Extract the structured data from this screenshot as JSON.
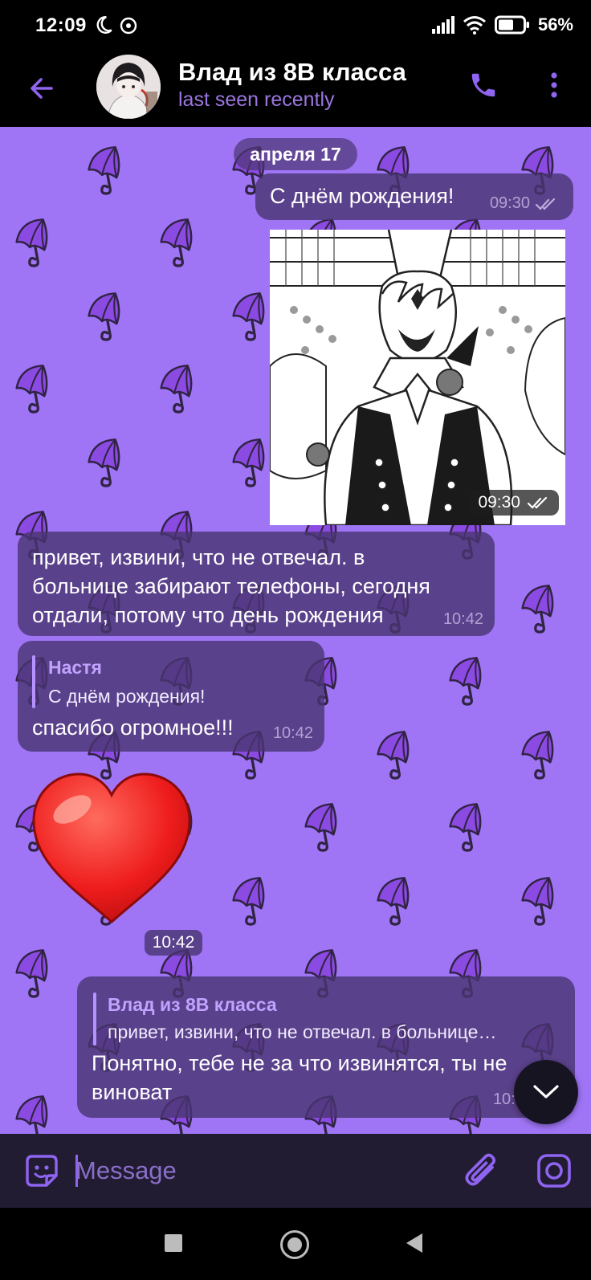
{
  "status_bar": {
    "time": "12:09",
    "battery": "56%"
  },
  "header": {
    "title": "Влад из 8В класса",
    "status": "last seen recently"
  },
  "chat": {
    "date_separator": "апреля 17",
    "messages": [
      {
        "id": "m1",
        "direction": "out",
        "text": "С днём рождения!",
        "time": "09:30",
        "status": "read"
      },
      {
        "id": "m2",
        "direction": "out",
        "type": "photo",
        "time": "09:30",
        "status": "read"
      },
      {
        "id": "m3",
        "direction": "in",
        "lines": [
          "привет, извини, что не отвечал. в",
          "больнице забирают телефоны, сегодня",
          "отдали, потому что день рождения"
        ],
        "time": "10:42"
      },
      {
        "id": "m4",
        "direction": "in",
        "reply_to": {
          "name": "Настя",
          "text": "С днём рождения!"
        },
        "text": "спасибо огромное!!!",
        "time": "10:42"
      },
      {
        "id": "m5",
        "direction": "in",
        "type": "sticker",
        "sticker": "red-heart",
        "time": "10:42"
      },
      {
        "id": "m6",
        "direction": "out",
        "reply_to": {
          "name": "Влад из 8В класса",
          "text": "привет, извини, что не отвечал. в больнице…"
        },
        "lines": [
          "Понятно, тебе не за что извинятся, ты не",
          "виноват"
        ],
        "time": "10:57",
        "status": "read"
      }
    ]
  },
  "composer": {
    "placeholder": "Message"
  },
  "colors": {
    "chat_background": "#9f75f6",
    "accent": "#8f64f0",
    "bubble": "#483470",
    "header": "#000000"
  },
  "icons": {
    "back": "arrow-left-icon",
    "call": "phone-icon",
    "menu": "more-vertical-icon",
    "emoji": "emoji-icon",
    "attach": "paperclip-icon",
    "camera": "instagram-camera-icon",
    "scroll": "chevron-down-icon"
  }
}
